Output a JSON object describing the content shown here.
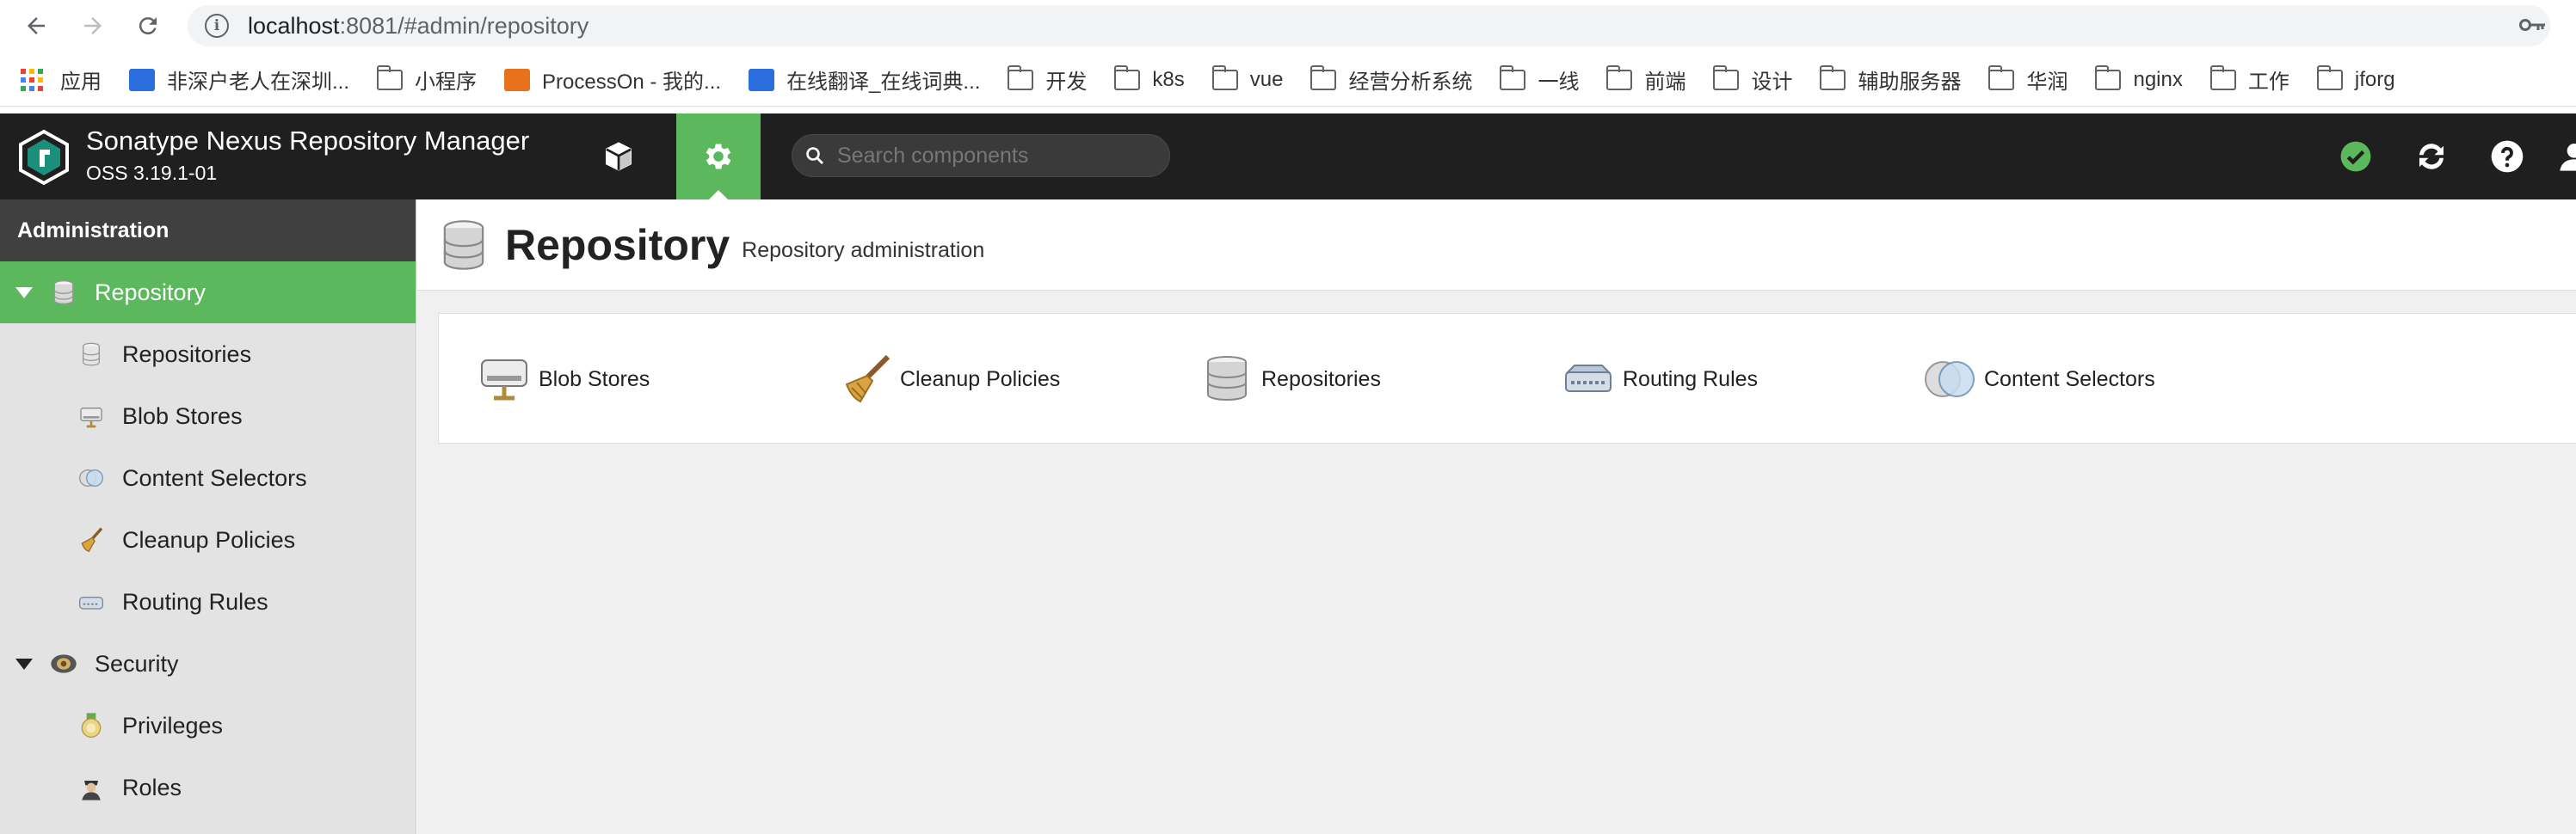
{
  "browser": {
    "url_host": "localhost",
    "url_rest": ":8081/#admin/repository",
    "bookmarks": [
      {
        "label": "应用",
        "type": "apps"
      },
      {
        "label": "非深户老人在深圳...",
        "type": "site"
      },
      {
        "label": "小程序",
        "type": "folder"
      },
      {
        "label": "ProcessOn - 我的...",
        "type": "site"
      },
      {
        "label": "在线翻译_在线词典...",
        "type": "site"
      },
      {
        "label": "开发",
        "type": "folder"
      },
      {
        "label": "k8s",
        "type": "folder"
      },
      {
        "label": "vue",
        "type": "folder"
      },
      {
        "label": "经营分析系统",
        "type": "folder"
      },
      {
        "label": "一线",
        "type": "folder"
      },
      {
        "label": "前端",
        "type": "folder"
      },
      {
        "label": "设计",
        "type": "folder"
      },
      {
        "label": "辅助服务器",
        "type": "folder"
      },
      {
        "label": "华润",
        "type": "folder"
      },
      {
        "label": "nginx",
        "type": "folder"
      },
      {
        "label": "工作",
        "type": "folder"
      },
      {
        "label": "jforg",
        "type": "folder"
      }
    ]
  },
  "header": {
    "title": "Sonatype Nexus Repository Manager",
    "version": "OSS 3.19.1-01",
    "search_placeholder": "Search components"
  },
  "sidebar": {
    "heading": "Administration",
    "groups": [
      {
        "label": "Repository",
        "active": true,
        "items": [
          "Repositories",
          "Blob Stores",
          "Content Selectors",
          "Cleanup Policies",
          "Routing Rules"
        ]
      },
      {
        "label": "Security",
        "active": false,
        "items": [
          "Privileges",
          "Roles"
        ]
      }
    ]
  },
  "main": {
    "title": "Repository",
    "subtitle": "Repository administration",
    "features": [
      "Blob Stores",
      "Cleanup Policies",
      "Repositories",
      "Routing Rules",
      "Content Selectors"
    ]
  },
  "colors": {
    "accent": "#5cb85c",
    "header_bg": "#1f1f1f",
    "sidebar_head_bg": "#404040"
  }
}
